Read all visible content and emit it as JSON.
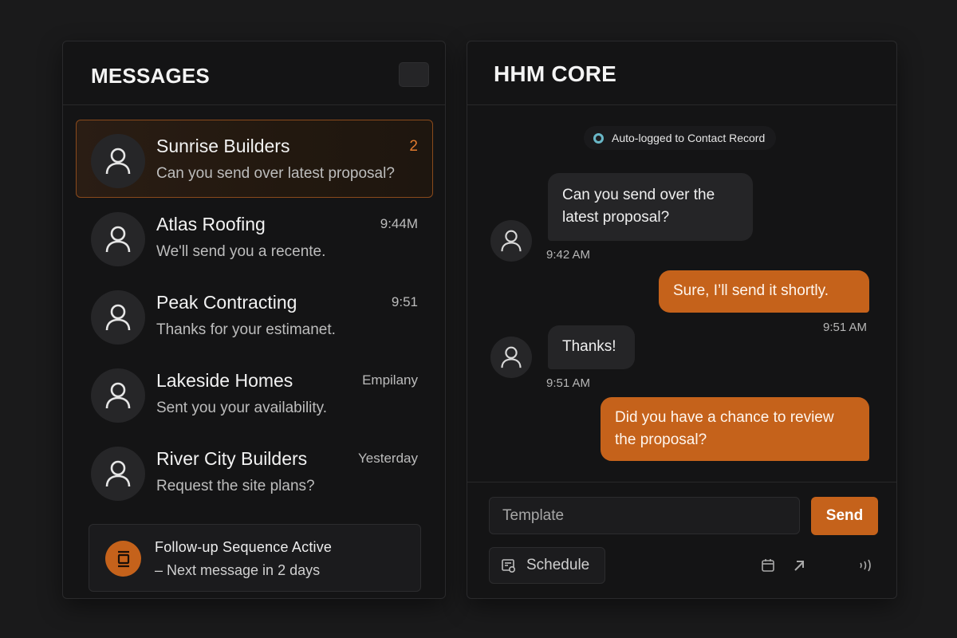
{
  "messages_panel": {
    "title": "MESSAGES",
    "conversations": [
      {
        "name": "Sunrise Builders",
        "preview": "Can you send over latest proposal?",
        "meta": "2",
        "active": true
      },
      {
        "name": "Atlas Roofing",
        "preview": "We'll send you a recente.",
        "meta": "9:44M",
        "active": false
      },
      {
        "name": "Peak Contracting",
        "preview": "Thanks for your estimanet.",
        "meta": "9:51",
        "active": false
      },
      {
        "name": "Lakeside Homes",
        "preview": "Sent you your availability.",
        "meta": "Empilany",
        "active": false
      },
      {
        "name": "River City Builders",
        "preview": "Request the site plans?",
        "meta": "Yesterday",
        "active": false
      }
    ],
    "followup": {
      "title": "Follow-up Sequence Active",
      "subtitle": "– Next message in 2 days"
    }
  },
  "chat_panel": {
    "title": "HHM CORE",
    "auto_logged": "Auto-logged to Contact Record",
    "messages": [
      {
        "direction": "in",
        "text_line1": "Can you send over the",
        "text_line2": "latest proposal?",
        "time": "9:42 AM"
      },
      {
        "direction": "out",
        "text_line1": "Sure, I’ll send it shortly.",
        "time": "9:51 AM"
      },
      {
        "direction": "in",
        "text_line1": "Thanks!",
        "time": "9:51 AM"
      },
      {
        "direction": "out",
        "text_line1": "Did you have a chance to review",
        "text_line2": "the proposal?"
      }
    ],
    "composer": {
      "placeholder": "Template",
      "send_label": "Send",
      "schedule_label": "Schedule"
    },
    "icons": [
      "calendar-icon",
      "arrow-up-right-icon",
      "signal-icon"
    ]
  },
  "colors": {
    "background": "#1a1a1b",
    "panel": "#141415",
    "accent": "#c5621b",
    "status_dot": "#69b7c7"
  }
}
